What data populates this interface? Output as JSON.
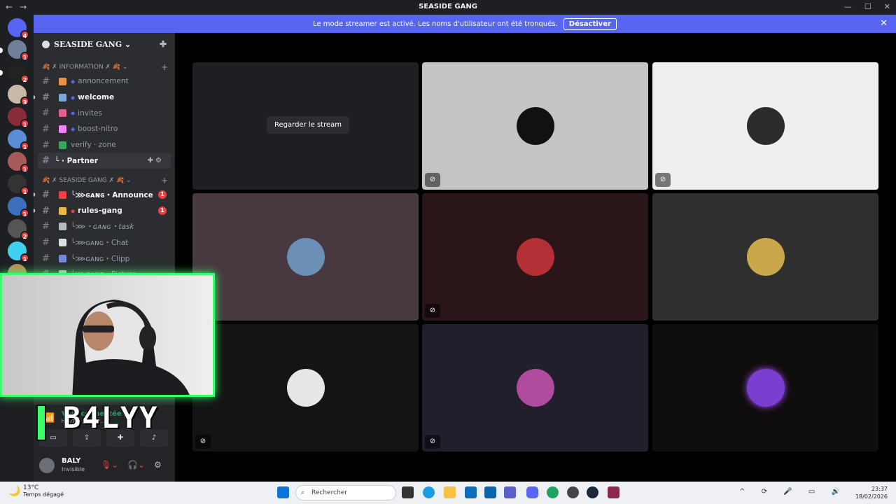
{
  "window": {
    "title": "SEASIDE GANG",
    "back": "←",
    "forward": "→",
    "controls": [
      "—",
      "☐",
      "✕"
    ]
  },
  "banner": {
    "text": "Le mode streamer est activé. Les noms d'utilisateur ont été tronqués.",
    "button": "Désactiver",
    "close": "✕"
  },
  "rail": {
    "badges": [
      "4",
      "1",
      "2",
      "3",
      "1",
      "1",
      "1",
      "1",
      "1",
      "2",
      "1",
      "1"
    ]
  },
  "guild": {
    "name": "SEASIDE GANG"
  },
  "categories": [
    {
      "label": "🍂 ✗ INFORMATION ✗ 🍂 ⌄"
    },
    {
      "label": "🍂 ✗ SEASIDE GANG ✗ 🍂 ⌄"
    }
  ],
  "channels_info": [
    {
      "name": "annoncement",
      "emoji": "#e8914b"
    },
    {
      "name": "welcome",
      "emoji": "#7aa8d9"
    },
    {
      "name": "invites",
      "emoji": "#e35b8f"
    },
    {
      "name": "boost-nitro",
      "emoji": "#f47fff"
    },
    {
      "name": "verify · zone",
      "emoji": "#3ba55d"
    },
    {
      "name": "└ · Partner",
      "emoji": ""
    }
  ],
  "channels_gang": [
    {
      "name": "╰⋙ɢᴀɴɢ・Announce",
      "emoji": "#f23f43",
      "badge": "1"
    },
    {
      "name": "rules-gang",
      "emoji": "#e9b84a",
      "badge": "1"
    },
    {
      "name": "╰⋙・ɢᴀɴɢ・task",
      "emoji": "#b5bac1"
    },
    {
      "name": "╰⋙ɢᴀɴɢ・Chat",
      "emoji": "#dbdee1"
    },
    {
      "name": "╰⋙ɢᴀɴɢ・Clipp",
      "emoji": "#7289da"
    },
    {
      "name": "╰⋙ɢᴀɴɢ・Picture",
      "emoji": "#b5bac1"
    }
  ],
  "voice": {
    "status": "Voix connectée",
    "sub": "Ⴙaly7oh / SEASI..."
  },
  "user": {
    "name": "BALY",
    "status": "Invisible"
  },
  "stream": {
    "watch_label": "Regarder le stream"
  },
  "tiles": [
    {
      "bg": "#1e1f22",
      "avatar": "",
      "mute": false,
      "watch": true
    },
    {
      "bg": "#c4c4c4",
      "avatar": "#111111",
      "mute": true
    },
    {
      "bg": "#efefef",
      "avatar": "#2b2b2b",
      "mute": true
    },
    {
      "bg": "#47393f",
      "avatar": "#6c8fb6",
      "mute": false
    },
    {
      "bg": "#2a1518",
      "avatar": "#b43036",
      "mute": true
    },
    {
      "bg": "#2f2f2f",
      "avatar": "#c9a74a",
      "mute": false
    },
    {
      "bg": "#141414",
      "avatar": "#e6e6e6",
      "mute": true
    },
    {
      "bg": "#221f2c",
      "avatar": "#b04c9e",
      "mute": true
    },
    {
      "bg": "#100d0d",
      "avatar": "#7a3fd1",
      "mute": false
    }
  ],
  "overlay": {
    "name": "B4LYY"
  },
  "taskbar": {
    "temp": "13°C",
    "weather": "Temps dégagé",
    "search": "Rechercher",
    "time": "23:37",
    "date": "18/02/2026"
  }
}
